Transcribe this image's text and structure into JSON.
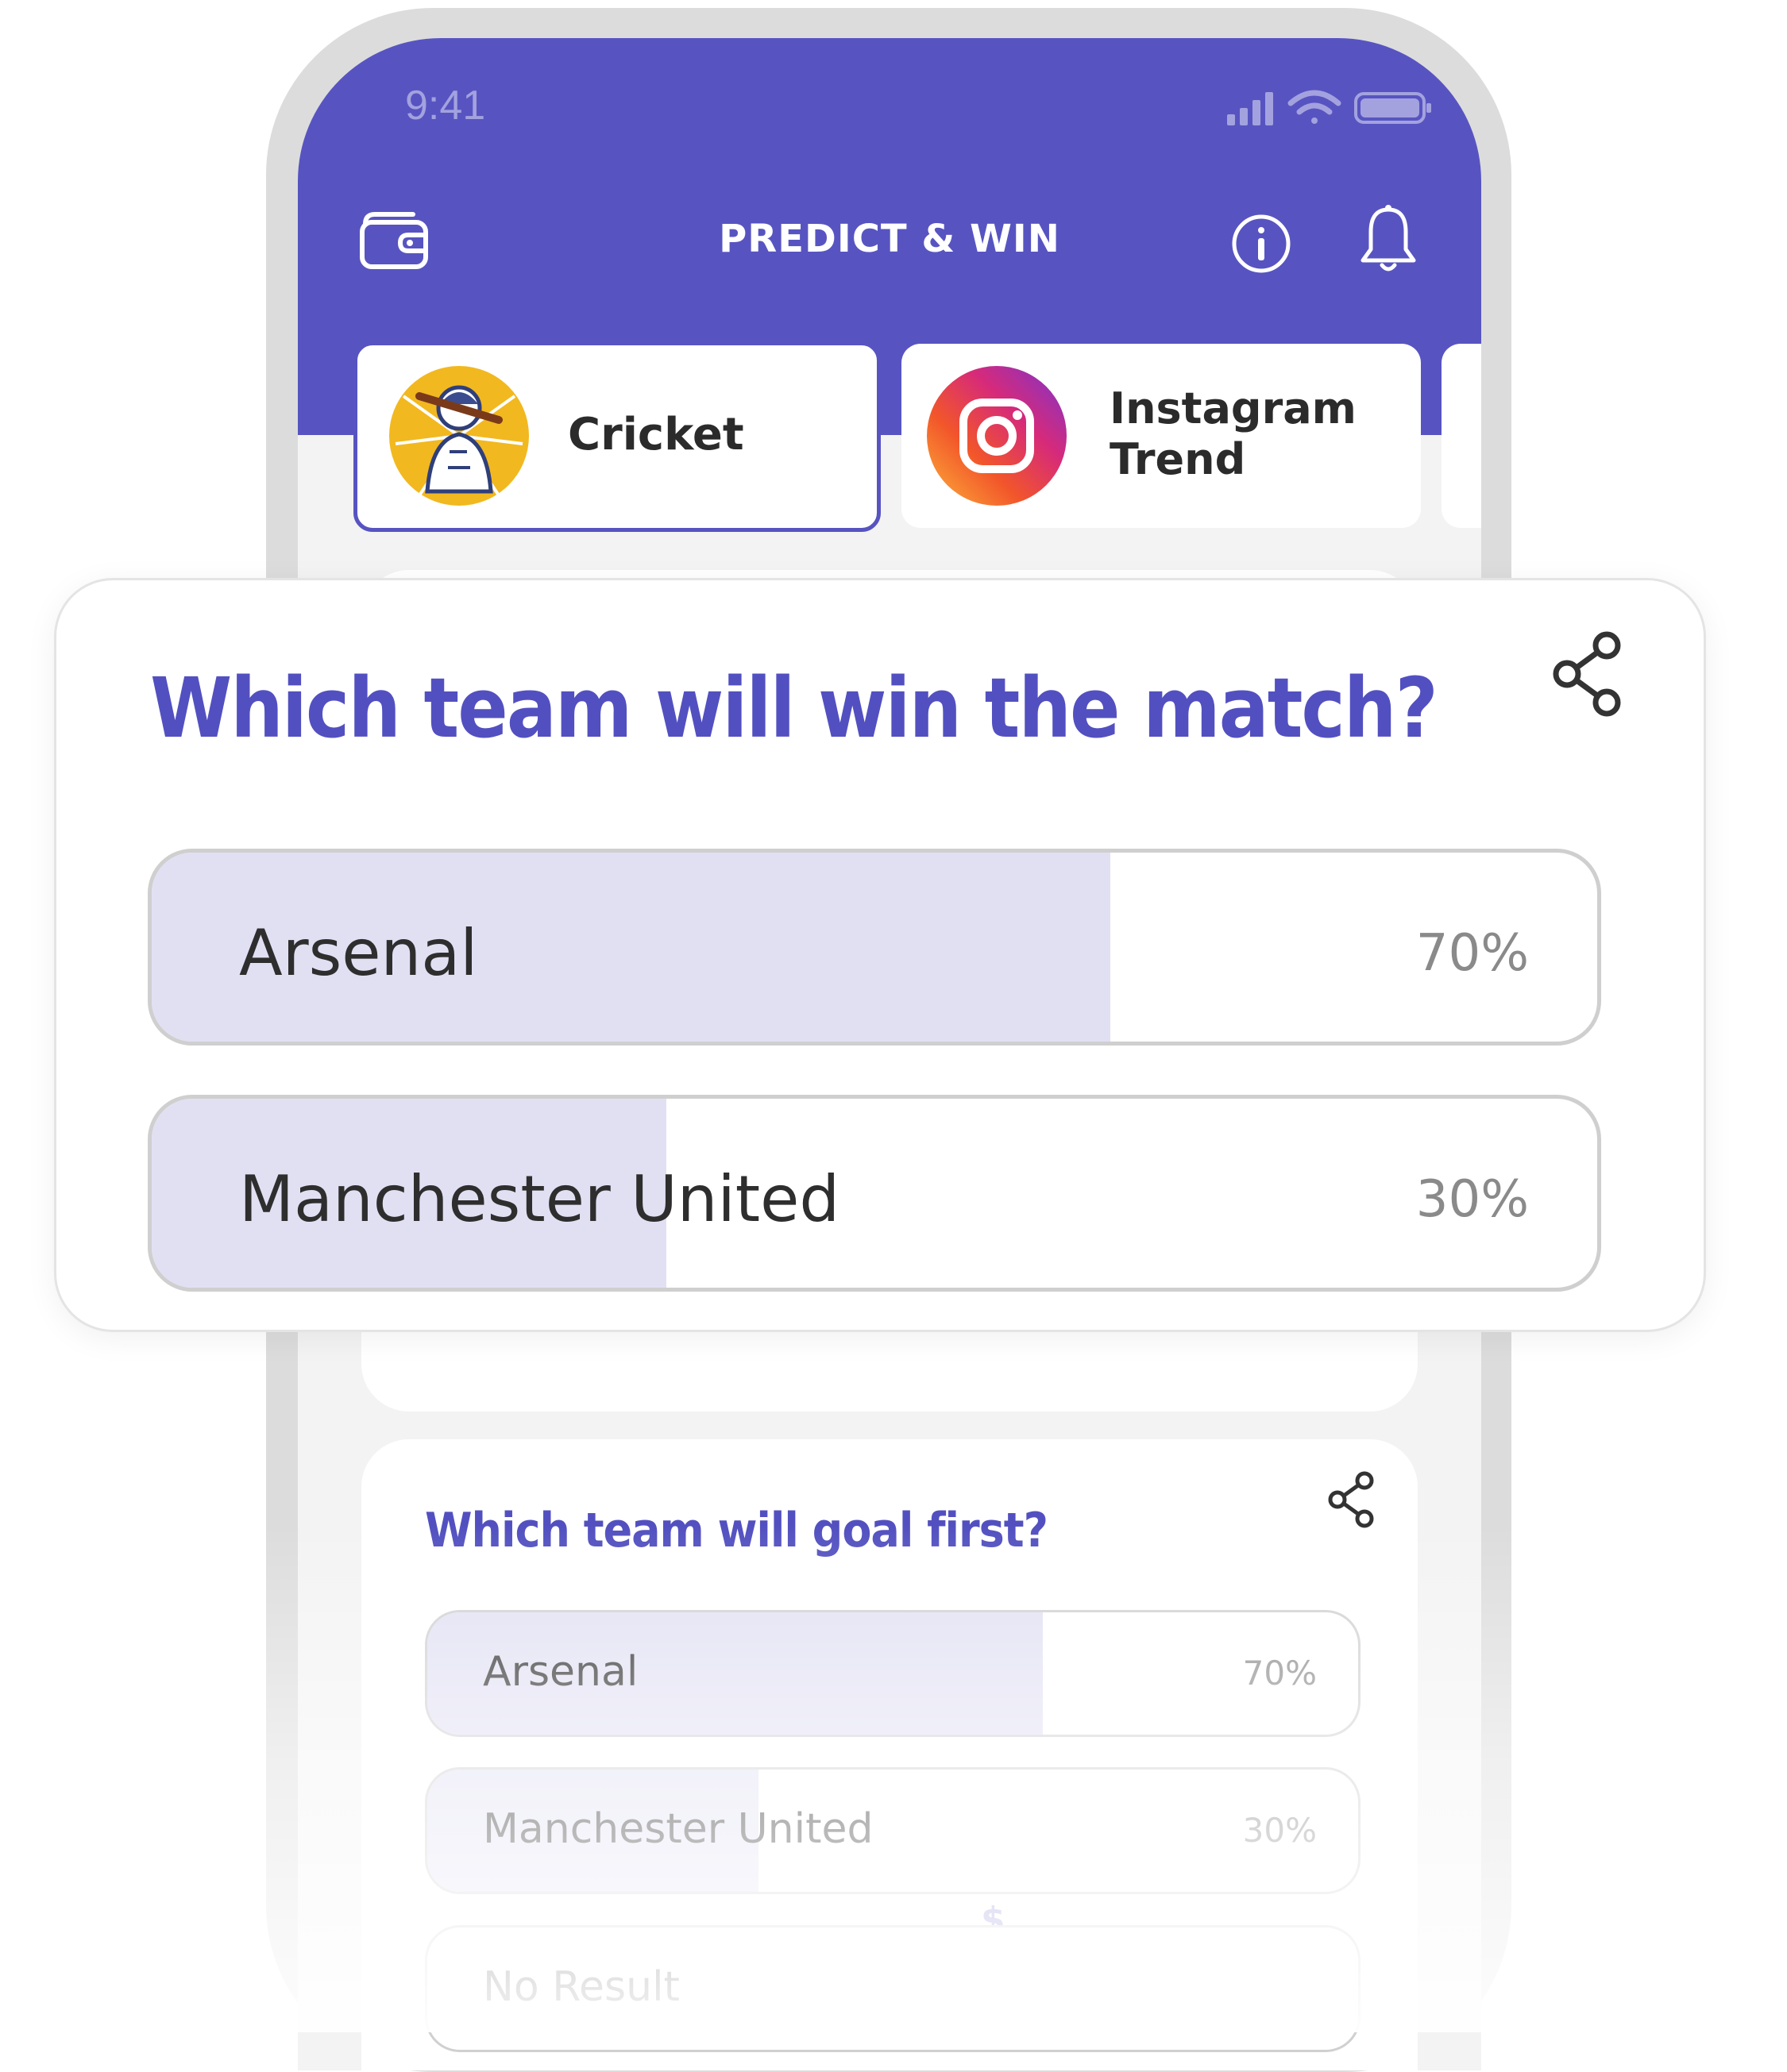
{
  "status_bar": {
    "time": "9:41"
  },
  "header": {
    "title": "PREDICT & WIN"
  },
  "categories": [
    {
      "label": "Cricket",
      "selected": true
    },
    {
      "label_line1": "Instagram",
      "label_line2": "Trend",
      "selected": false
    }
  ],
  "featured_poll": {
    "question": "Which team will win the match?",
    "options": [
      {
        "label": "Arsenal",
        "percent": "70%",
        "share": 0.7
      },
      {
        "label": "Manchester United",
        "percent": "30%",
        "share": 0.3
      }
    ]
  },
  "second_poll": {
    "question": "Which team will goal first?",
    "options": [
      {
        "label": "Arsenal",
        "percent": "70%",
        "share": 0.7
      },
      {
        "label": "Manchester United",
        "percent": "30%",
        "share": 0.3
      },
      {
        "label": "No Result",
        "percent": "",
        "share": 0
      }
    ],
    "currency_symbol": "$"
  },
  "colors": {
    "brand": "#5754c1",
    "fill": "#e1e0f3",
    "title": "#5250c0"
  }
}
